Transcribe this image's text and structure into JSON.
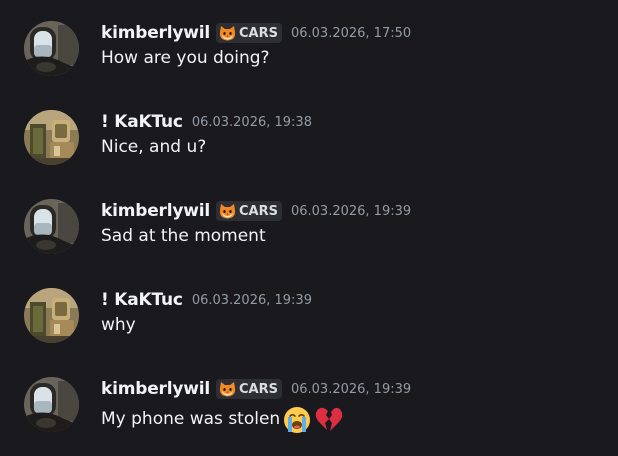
{
  "messages": [
    {
      "username": "kimberlywil",
      "tag": "CARS",
      "tag_icon": "cat-face-icon",
      "timestamp": "06.03.2026, 17:50",
      "text": "How are you doing?",
      "avatar": "window-seat-avatar"
    },
    {
      "username": "! KaKTuc",
      "timestamp": "06.03.2026, 19:38",
      "text": "Nice, and u?",
      "avatar": "cactus-avatar"
    },
    {
      "username": "kimberlywil",
      "tag": "CARS",
      "tag_icon": "cat-face-icon",
      "timestamp": "06.03.2026, 19:39",
      "text": "Sad at the moment",
      "avatar": "window-seat-avatar"
    },
    {
      "username": "! KaKTuc",
      "timestamp": "06.03.2026, 19:39",
      "text": "why",
      "avatar": "cactus-avatar"
    },
    {
      "username": "kimberlywil",
      "tag": "CARS",
      "tag_icon": "cat-face-icon",
      "timestamp": "06.03.2026, 19:39",
      "text": "My phone was stolen",
      "avatar": "window-seat-avatar",
      "emojis": [
        "loudly-crying-face-emoji",
        "broken-heart-emoji"
      ]
    }
  ],
  "colors": {
    "background": "#1a1a1e",
    "username": "#f2f3f5",
    "timestamp": "#949ba4",
    "tag_background": "#2e2f34"
  }
}
